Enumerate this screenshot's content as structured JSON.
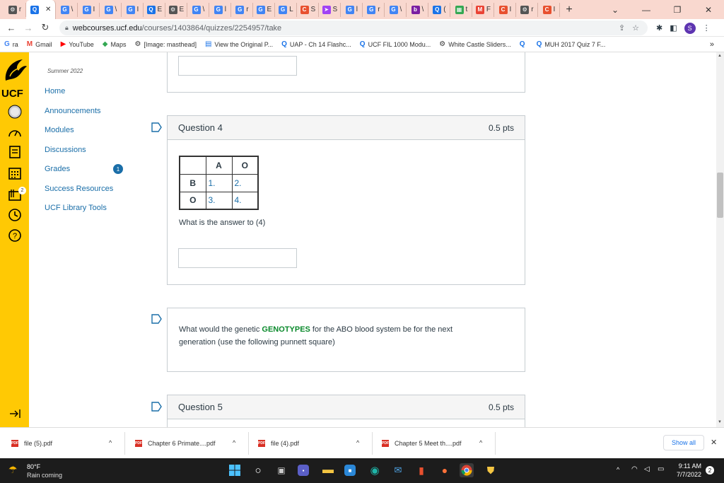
{
  "browser": {
    "tabs": [
      {
        "letter": "⚙",
        "text": "r",
        "color": "#555"
      },
      {
        "letter": "Q",
        "text": "",
        "color": "#1a73e8",
        "active": true
      },
      {
        "letter": "G",
        "text": "\\",
        "color": "#4285f4"
      },
      {
        "letter": "G",
        "text": "I",
        "color": "#4285f4"
      },
      {
        "letter": "G",
        "text": "\\",
        "color": "#4285f4"
      },
      {
        "letter": "G",
        "text": "I",
        "color": "#4285f4"
      },
      {
        "letter": "Q",
        "text": "E",
        "color": "#1a73e8"
      },
      {
        "letter": "⚙",
        "text": "E",
        "color": "#555"
      },
      {
        "letter": "G",
        "text": "\\",
        "color": "#4285f4"
      },
      {
        "letter": "G",
        "text": "l",
        "color": "#4285f4"
      },
      {
        "letter": "G",
        "text": "r",
        "color": "#4285f4"
      },
      {
        "letter": "G",
        "text": "E",
        "color": "#4285f4"
      },
      {
        "letter": "G",
        "text": "L",
        "color": "#4285f4"
      },
      {
        "letter": "C",
        "text": "S",
        "color": "#e8502f"
      },
      {
        "letter": "➤",
        "text": "S",
        "color": "#a142f4"
      },
      {
        "letter": "G",
        "text": "l",
        "color": "#4285f4"
      },
      {
        "letter": "G",
        "text": "r",
        "color": "#4285f4"
      },
      {
        "letter": "G",
        "text": "\\",
        "color": "#4285f4"
      },
      {
        "letter": "b",
        "text": "\\",
        "color": "#7b1fa2"
      },
      {
        "letter": "Q",
        "text": "(",
        "color": "#1a73e8"
      },
      {
        "letter": "▦",
        "text": "t",
        "color": "#34a853"
      },
      {
        "letter": "M",
        "text": "F",
        "color": "#ea4335"
      },
      {
        "letter": "C",
        "text": "I",
        "color": "#e8502f"
      },
      {
        "letter": "⚙",
        "text": "r",
        "color": "#555"
      },
      {
        "letter": "C",
        "text": "I",
        "color": "#e8502f"
      }
    ],
    "url_domain": "webcourses.ucf.edu",
    "url_path": "/courses/1403864/quizzes/2254957/take",
    "profile_initial": "S",
    "bookmarks": [
      {
        "icon": "G",
        "label": "ra",
        "color": "#4285f4"
      },
      {
        "icon": "M",
        "label": "Gmail",
        "color": "#ea4335"
      },
      {
        "icon": "▶",
        "label": "YouTube",
        "color": "#ff0000"
      },
      {
        "icon": "◆",
        "label": "Maps",
        "color": "#34a853"
      },
      {
        "icon": "⚙",
        "label": "[Image: masthead]",
        "color": "#333"
      },
      {
        "icon": "▤",
        "label": "View the Original P...",
        "color": "#1a73e8"
      },
      {
        "icon": "Q",
        "label": "UAP - Ch 14 Flashc...",
        "color": "#1a73e8"
      },
      {
        "icon": "Q",
        "label": "UCF FIL 1000 Modu...",
        "color": "#1a73e8"
      },
      {
        "icon": "⚙",
        "label": "White Castle Sliders...",
        "color": "#333"
      },
      {
        "icon": "Q",
        "label": "",
        "color": "#1a73e8"
      },
      {
        "icon": "Q",
        "label": "MUH 2017 Quiz 7 F...",
        "color": "#1a73e8"
      }
    ],
    "bookmarks_more": "»"
  },
  "globalnav": {
    "logo_text": "UCF",
    "inbox_badge": "2"
  },
  "coursenav": {
    "term": "Summer 2022",
    "items": [
      {
        "label": "Home"
      },
      {
        "label": "Announcements"
      },
      {
        "label": "Modules"
      },
      {
        "label": "Discussions"
      },
      {
        "label": "Grades"
      },
      {
        "label": "Success Resources"
      },
      {
        "label": "UCF Library Tools"
      }
    ],
    "grades_badge": "1"
  },
  "quiz": {
    "q4": {
      "title": "Question 4",
      "points": "0.5 pts",
      "table": {
        "col_headers": [
          "A",
          "O"
        ],
        "rows": [
          {
            "header": "B",
            "cells": [
              "1.",
              "2."
            ]
          },
          {
            "header": "O",
            "cells": [
              "3.",
              "4."
            ]
          }
        ]
      },
      "prompt": "What is the answer to (4)",
      "answer_value": ""
    },
    "text_block": {
      "before": "What would the genetic ",
      "highlight": "GENOTYPES",
      "after": " for the ABO blood system be for the next",
      "line2": "generation (use the following punnett square)"
    },
    "q5": {
      "title": "Question 5",
      "points": "0.5 pts"
    }
  },
  "downloads": {
    "items": [
      {
        "label": "file (5).pdf"
      },
      {
        "label": "Chapter 6 Primate....pdf"
      },
      {
        "label": "file (4).pdf"
      },
      {
        "label": "Chapter 5 Meet th....pdf"
      }
    ],
    "show_all": "Show all"
  },
  "taskbar": {
    "weather_temp": "80°F",
    "weather_desc": "Rain coming",
    "time": "9:11 AM",
    "date": "7/7/2022",
    "notif_count": "2"
  }
}
